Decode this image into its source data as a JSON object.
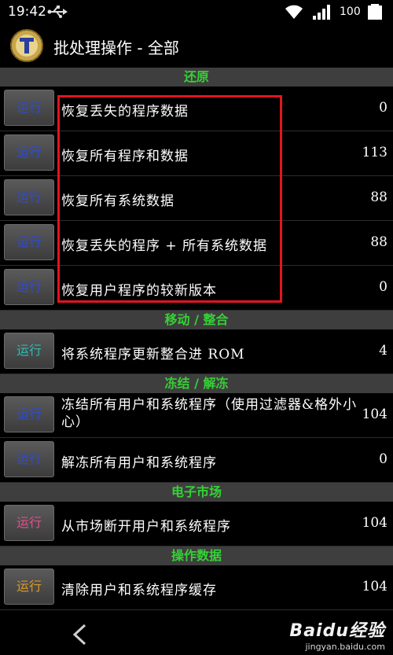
{
  "status_bar": {
    "time": "19:42",
    "battery": "100",
    "icons": [
      "usb-icon",
      "wifi-icon",
      "signal-icon",
      "battery-icon"
    ]
  },
  "app_bar": {
    "title": "批处理操作 - 全部",
    "icon": "titanium-backup-icon"
  },
  "colors": {
    "section_text": "#35d135",
    "section_bg": "#3e3e3e",
    "highlight": "#e2141f"
  },
  "sections": [
    {
      "title": "还原",
      "rows": [
        {
          "button": "运行",
          "button_color": "#2f4bd1",
          "label": "恢复丢失的程序数据",
          "count": "0"
        },
        {
          "button": "运行",
          "button_color": "#2f4bd1",
          "label": "恢复所有程序和数据",
          "count": "113"
        },
        {
          "button": "运行",
          "button_color": "#2f4bd1",
          "label": "恢复所有系统数据",
          "count": "88"
        },
        {
          "button": "运行",
          "button_color": "#2f4bd1",
          "label": "恢复丢失的程序 + 所有系统数据",
          "count": "88"
        },
        {
          "button": "运行",
          "button_color": "#2f4bd1",
          "label": "恢复用户程序的较新版本",
          "count": "0"
        }
      ]
    },
    {
      "title": "移动 / 整合",
      "rows": [
        {
          "button": "运行",
          "button_color": "#31b8b0",
          "label": "将系统程序更新整合进 ROM",
          "count": "4"
        }
      ]
    },
    {
      "title": "冻结 / 解冻",
      "rows": [
        {
          "button": "运行",
          "button_color": "#2f4bd1",
          "label": "冻结所有用户和系统程序（使用过滤器&格外小心）",
          "count": "104",
          "wrap": true
        },
        {
          "button": "运行",
          "button_color": "#2f4bd1",
          "label": "解冻所有用户和系统程序",
          "count": "0"
        }
      ]
    },
    {
      "title": "电子市场",
      "rows": [
        {
          "button": "运行",
          "button_color": "#e0508a",
          "label": "从市场断开用户和系统程序",
          "count": "104"
        }
      ]
    },
    {
      "title": "操作数据",
      "rows": [
        {
          "button": "运行",
          "button_color": "#d89a2a",
          "label": "清除用户和系统程序缓存",
          "count": "104"
        }
      ]
    }
  ],
  "nav": {
    "back": "back-icon"
  },
  "watermark": {
    "logo": "Baidu经验",
    "domain": "jingyan.baidu.com"
  }
}
